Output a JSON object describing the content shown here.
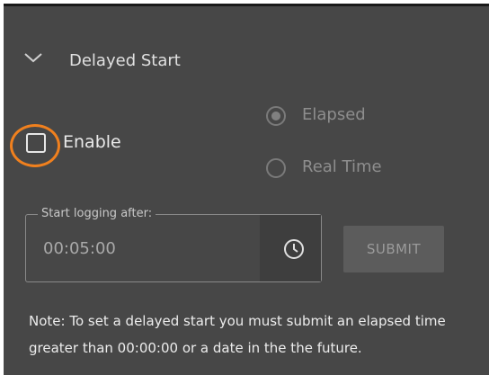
{
  "section": {
    "title": "Delayed Start",
    "expanded": true,
    "chevron_icon": "chevron-down-icon"
  },
  "enable": {
    "label": "Enable",
    "checked": false,
    "highlight_color": "#f0801e"
  },
  "mode": {
    "options": [
      {
        "label": "Elapsed",
        "selected": true
      },
      {
        "label": "Real Time",
        "selected": false
      }
    ]
  },
  "start_field": {
    "legend": "Start logging after:",
    "value": "00:05:00",
    "icon": "clock-icon"
  },
  "submit": {
    "label": "SUBMIT",
    "disabled": true
  },
  "note": "Note: To set a delayed start you must submit an elapsed time greater than 00:00:00 or a date in the the future.",
  "colors": {
    "panel_bg": "#474747",
    "accent": "#f0801e"
  }
}
